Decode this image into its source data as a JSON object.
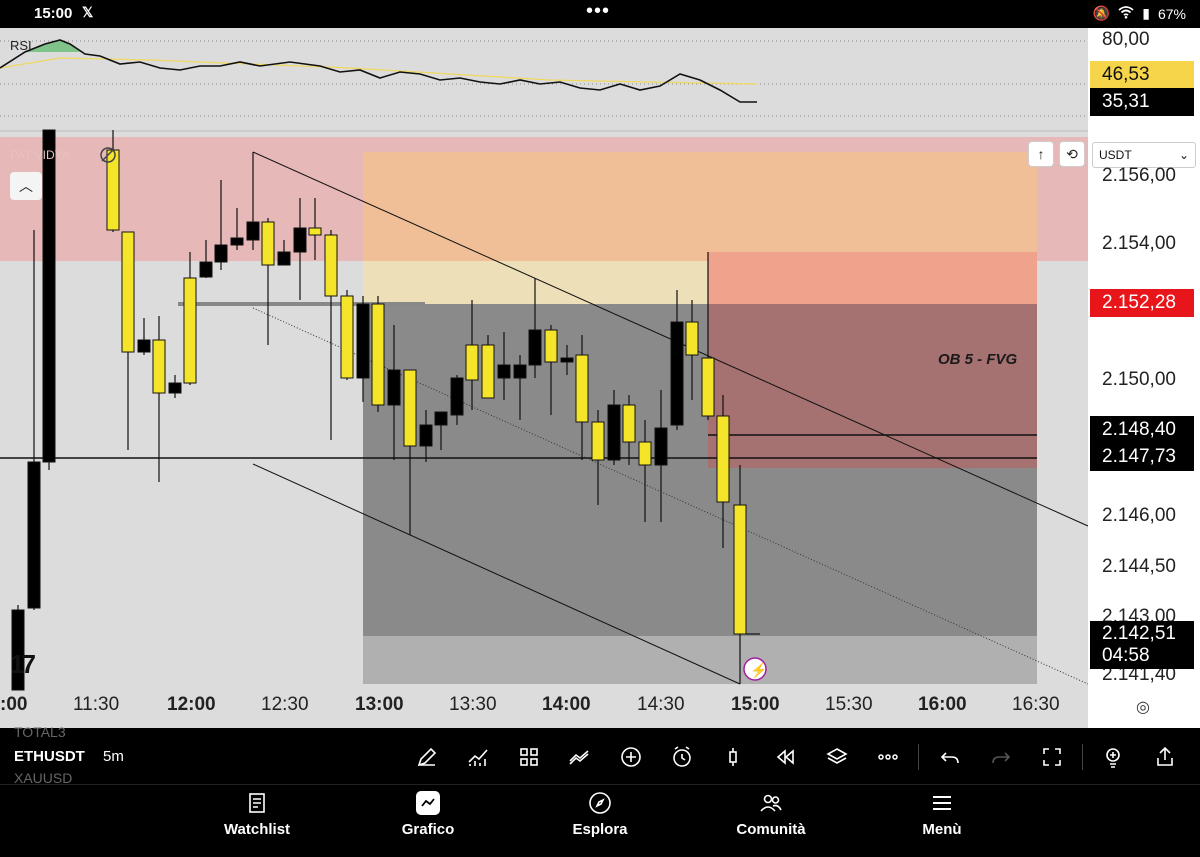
{
  "status_bar": {
    "time": "15:00",
    "battery": "67%"
  },
  "chart": {
    "indicator_rsi": "RSI",
    "indicator_overlay": "PAT VIDYA",
    "currency_select": "USDT",
    "annotation": "OB 5 - FVG",
    "price_axis": [
      "80,00",
      "2.156,00",
      "2.154,00",
      "2.150,00",
      "2.146,00",
      "2.144,50",
      "2.143,00",
      "2.141,40"
    ],
    "price_tags": {
      "rsi_signal": "46,53",
      "rsi_value": "35,31",
      "current_price": "2.152,28",
      "line_1": "2.148,40",
      "line_2": "2.147,73",
      "last_price": "2.142,51",
      "countdown": "04:58"
    },
    "time_axis": [
      {
        "label": ":00",
        "bold": true
      },
      {
        "label": "11:30",
        "bold": false
      },
      {
        "label": "12:00",
        "bold": true
      },
      {
        "label": "12:30",
        "bold": false
      },
      {
        "label": "13:00",
        "bold": true
      },
      {
        "label": "13:30",
        "bold": false
      },
      {
        "label": "14:00",
        "bold": true
      },
      {
        "label": "14:30",
        "bold": false
      },
      {
        "label": "15:00",
        "bold": true
      },
      {
        "label": "15:30",
        "bold": false
      },
      {
        "label": "16:00",
        "bold": true
      },
      {
        "label": "16:30",
        "bold": false
      }
    ],
    "colors": {
      "bull_candle": "#f5e52a",
      "bear_candle": "#000000",
      "supply_zone": "#e8b4b4",
      "fvg_zone": "#f0b98a",
      "range_box": "#8a8a8a"
    }
  },
  "toolbar": {
    "symbol_above": "TOTAL3",
    "symbol": "ETHUSDT",
    "symbol_below": "XAUUSD",
    "interval": "5m",
    "tools": [
      "draw-icon",
      "indicators-icon",
      "templates-icon",
      "strategy-icon",
      "add-icon",
      "alert-icon",
      "chart-type-icon",
      "replay-icon",
      "layers-icon",
      "more-icon",
      "undo-icon",
      "redo-icon",
      "fullscreen-icon",
      "idea-icon",
      "share-icon"
    ]
  },
  "nav": {
    "items": [
      {
        "label": "Watchlist",
        "icon": "list-icon"
      },
      {
        "label": "Grafico",
        "icon": "chart-icon",
        "active": true
      },
      {
        "label": "Esplora",
        "icon": "compass-icon"
      },
      {
        "label": "Comunità",
        "icon": "people-icon"
      },
      {
        "label": "Menù",
        "icon": "menu-icon"
      }
    ]
  }
}
